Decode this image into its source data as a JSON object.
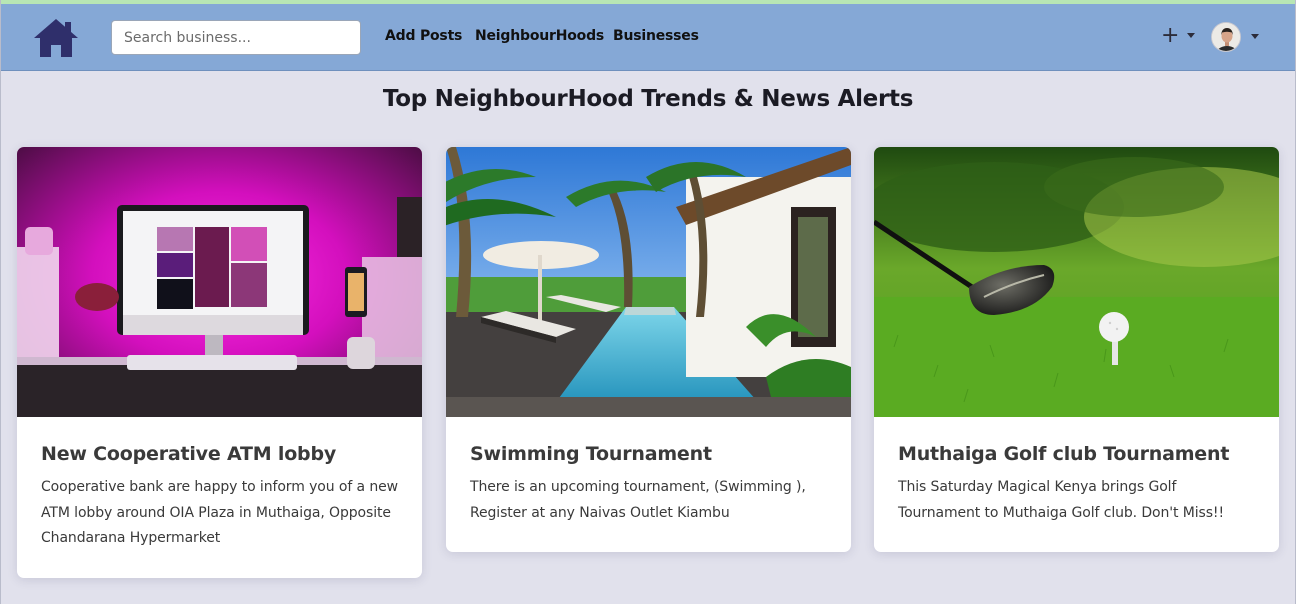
{
  "nav": {
    "search": {
      "placeholder": "Search business..."
    },
    "links": [
      "Add Posts",
      "NeighbourHoods",
      "Businesses"
    ],
    "icons": {
      "home": "home-icon",
      "plus": "plus-icon",
      "avatar": "user-avatar"
    },
    "plus_symbol": "+"
  },
  "page": {
    "heading": "Top NeighbourHood Trends & News Alerts"
  },
  "cards": [
    {
      "title": "New Cooperative ATM lobby",
      "text": "Cooperative bank are happy to inform you of a new ATM lobby around OIA Plaza in Muthaiga, Opposite Chandarana Hypermarket",
      "image": "desk-computer-pink-light"
    },
    {
      "title": "Swimming Tournament",
      "text": "There is an upcoming tournament, (Swimming ), Register at any Naivas Outlet Kiambu",
      "image": "resort-pool-palm-trees"
    },
    {
      "title": "Muthaiga Golf club Tournament",
      "text": "This Saturday Magical Kenya brings Golf Tournament to Muthaiga Golf club. Don't Miss!!",
      "image": "golf-club-ball-tee"
    }
  ],
  "colors": {
    "navbar": "#85a8d6",
    "page_bg": "#e1e1ec",
    "accent_line": "#b8e6b4"
  }
}
